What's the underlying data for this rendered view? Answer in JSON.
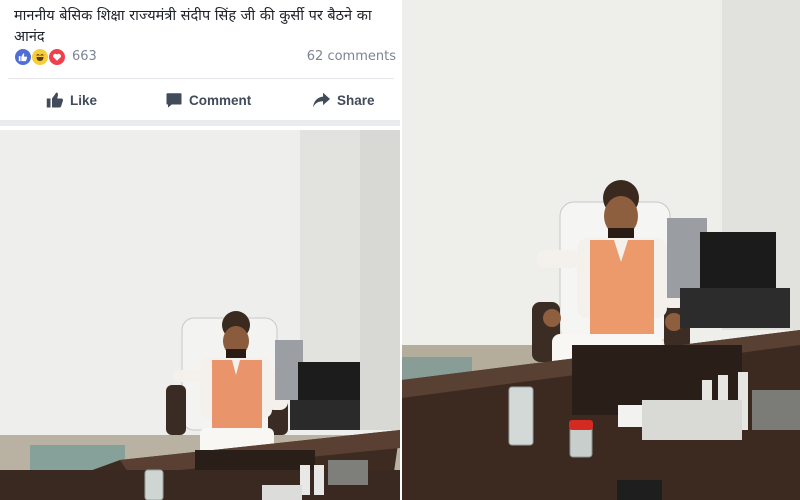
{
  "post": {
    "text": "माननीय बेसिक शिक्षा राज्यमंत्री संदीप सिंह जी की कुर्सी पर बैठने का आनंद",
    "reaction_count": "663",
    "comments_count": "62 comments",
    "reactions": [
      "like",
      "haha",
      "love"
    ],
    "actions": {
      "like_label": "Like",
      "comment_label": "Comment",
      "share_label": "Share"
    }
  },
  "icons": {
    "like": "thumbs-up-icon",
    "comment": "speech-bubble-icon",
    "share": "share-arrow-icon"
  },
  "colors": {
    "like_reaction": "#4f6fd6",
    "haha_reaction": "#f6cd3b",
    "love_reaction": "#f0404d",
    "action_text": "#414b5a",
    "meta_text": "#7c8595"
  }
}
